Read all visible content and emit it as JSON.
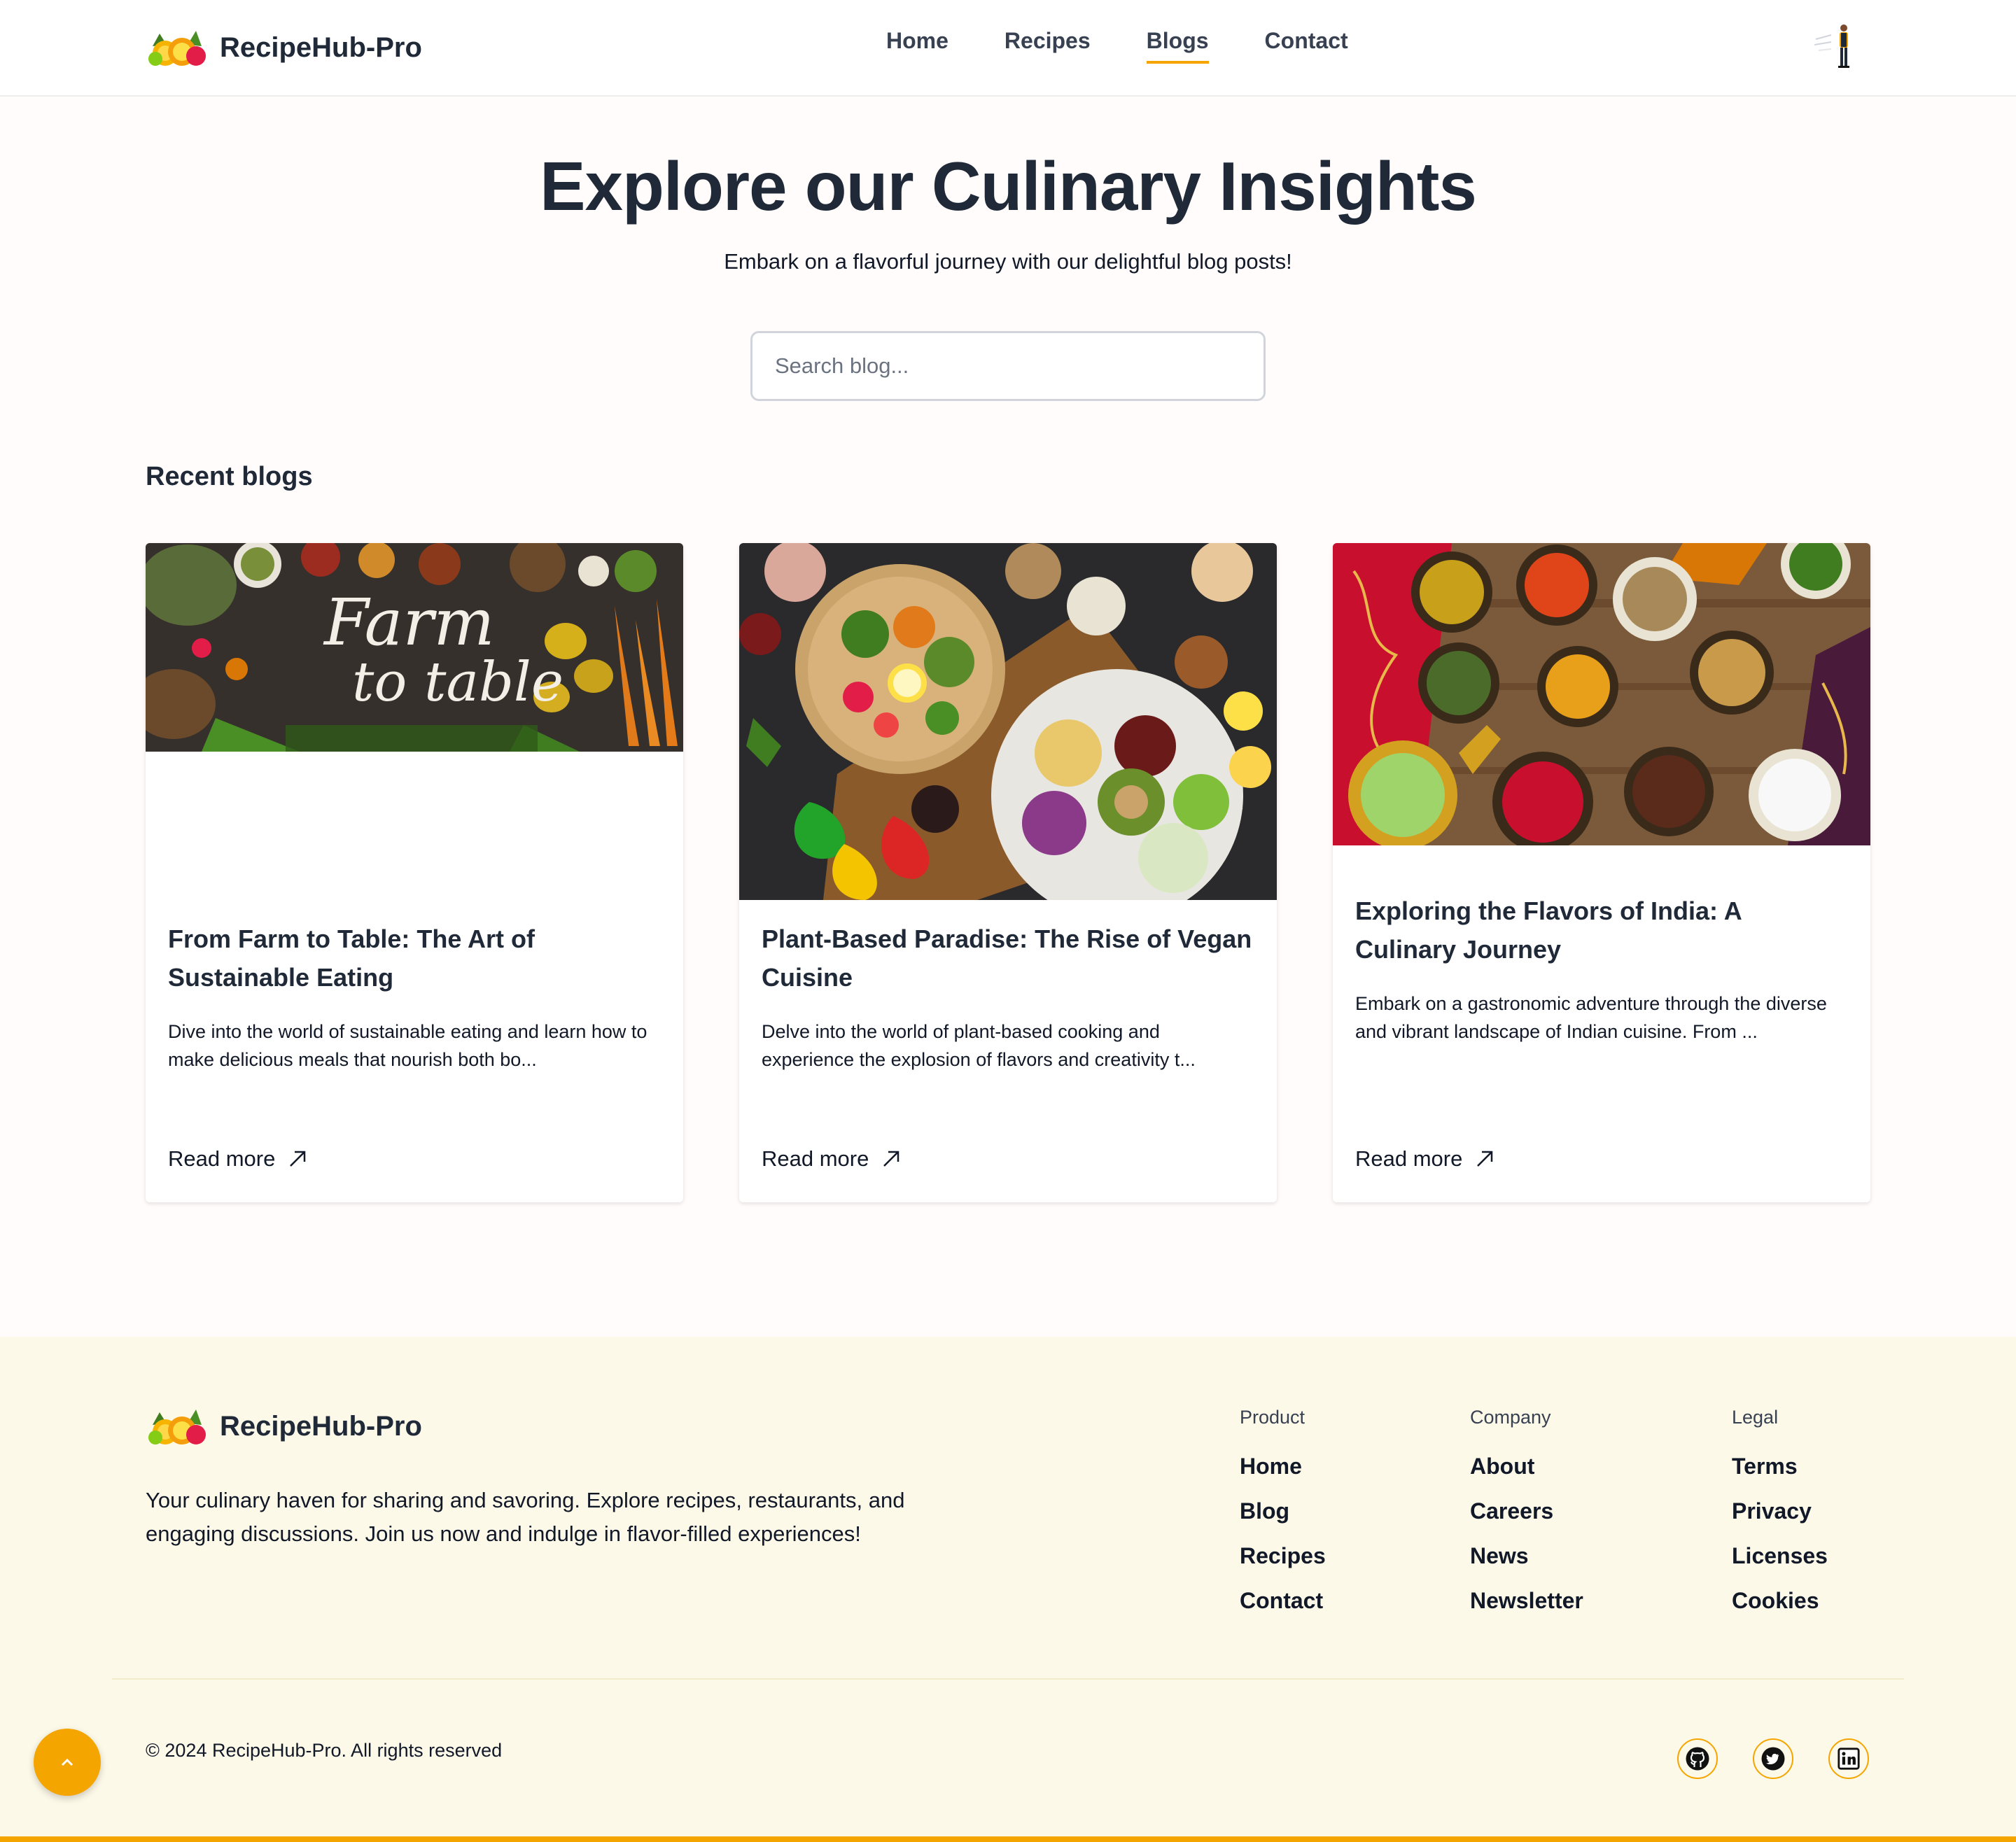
{
  "header": {
    "brand": "RecipeHub-Pro",
    "nav": [
      {
        "label": "Home",
        "active": false
      },
      {
        "label": "Recipes",
        "active": false
      },
      {
        "label": "Blogs",
        "active": true
      },
      {
        "label": "Contact",
        "active": false
      }
    ],
    "accent_color": "#f5a500"
  },
  "hero": {
    "title": "Explore our Culinary Insights",
    "subtitle": "Embark on a flavorful journey with our delightful blog posts!",
    "search_placeholder": "Search blog..."
  },
  "recent": {
    "heading": "Recent blogs",
    "posts": [
      {
        "title": "From Farm to Table: The Art of Sustainable Eating",
        "excerpt": "Dive into the world of sustainable eating and learn how to make delicious meals that nourish both bo...",
        "link": "Read more",
        "image_text_1": "Farm",
        "image_text_2": "to table"
      },
      {
        "title": "Plant-Based Paradise: The Rise of Vegan Cuisine",
        "excerpt": "Delve into the world of plant-based cooking and experience the explosion of flavors and creativity t...",
        "link": "Read more"
      },
      {
        "title": "Exploring the Flavors of India: A Culinary Journey",
        "excerpt": "Embark on a gastronomic adventure through the diverse and vibrant landscape of Indian cuisine. From ...",
        "link": "Read more"
      }
    ]
  },
  "footer": {
    "brand": "RecipeHub-Pro",
    "about": "Your culinary haven for sharing and savoring. Explore recipes, restaurants, and engaging discussions. Join us now and indulge in flavor-filled experiences!",
    "columns": [
      {
        "heading": "Product",
        "links": [
          "Home",
          "Blog",
          "Recipes",
          "Contact"
        ]
      },
      {
        "heading": "Company",
        "links": [
          "About",
          "Careers",
          "News",
          "Newsletter"
        ]
      },
      {
        "heading": "Legal",
        "links": [
          "Terms",
          "Privacy",
          "Licenses",
          "Cookies"
        ]
      }
    ],
    "copyright": "© 2024 RecipeHub-Pro. All rights reserved",
    "social": [
      "github-icon",
      "twitter-icon",
      "linkedin-icon"
    ]
  }
}
